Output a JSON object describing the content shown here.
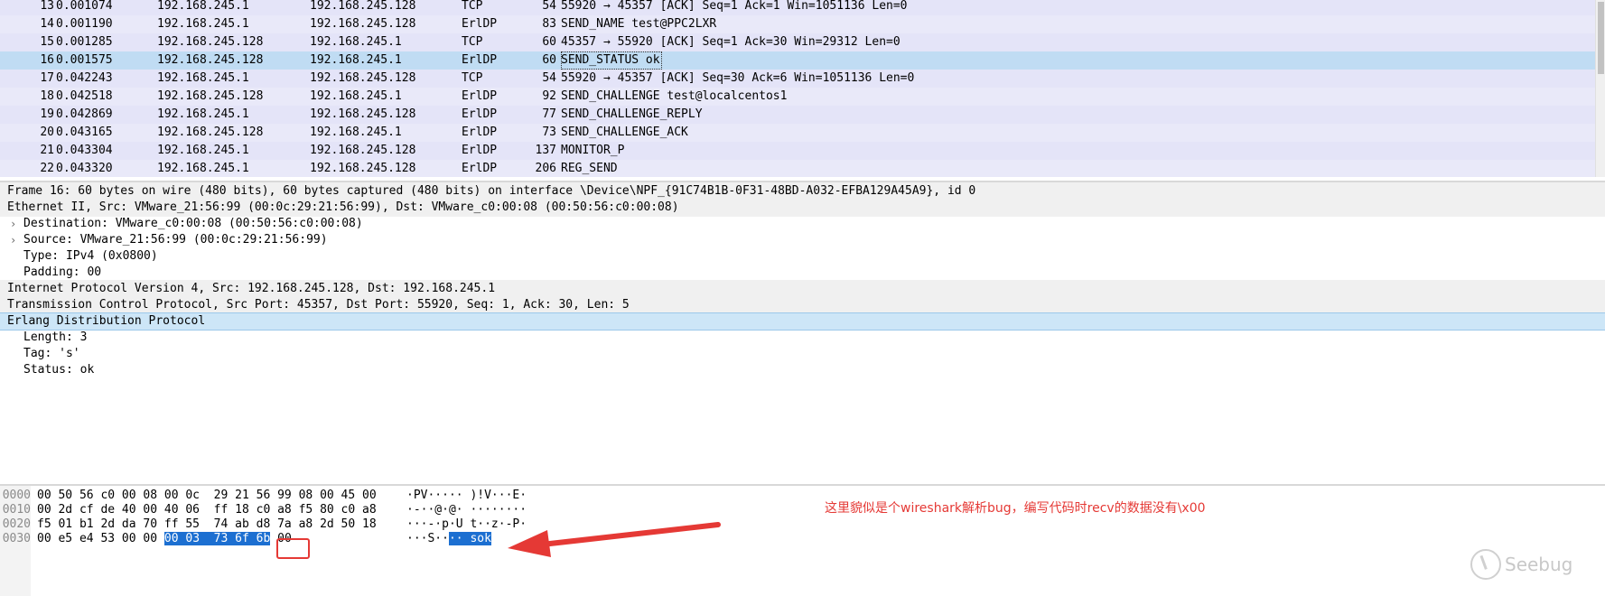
{
  "packet_list": {
    "rows": [
      {
        "no": "13",
        "time": "0.001074",
        "src": "192.168.245.1",
        "dst": "192.168.245.128",
        "proto": "TCP",
        "len": "54",
        "info": "55920 → 45357 [ACK] Seq=1 Ack=1 Win=1051136 Len=0"
      },
      {
        "no": "14",
        "time": "0.001190",
        "src": "192.168.245.1",
        "dst": "192.168.245.128",
        "proto": "ErlDP",
        "len": "83",
        "info": "SEND_NAME test@PPC2LXR"
      },
      {
        "no": "15",
        "time": "0.001285",
        "src": "192.168.245.128",
        "dst": "192.168.245.1",
        "proto": "TCP",
        "len": "60",
        "info": "45357 → 55920 [ACK] Seq=1 Ack=30 Win=29312 Len=0"
      },
      {
        "no": "16",
        "time": "0.001575",
        "src": "192.168.245.128",
        "dst": "192.168.245.1",
        "proto": "ErlDP",
        "len": "60",
        "info": "SEND_STATUS ok"
      },
      {
        "no": "17",
        "time": "0.042243",
        "src": "192.168.245.1",
        "dst": "192.168.245.128",
        "proto": "TCP",
        "len": "54",
        "info": "55920 → 45357 [ACK] Seq=30 Ack=6 Win=1051136 Len=0"
      },
      {
        "no": "18",
        "time": "0.042518",
        "src": "192.168.245.128",
        "dst": "192.168.245.1",
        "proto": "ErlDP",
        "len": "92",
        "info": "SEND_CHALLENGE test@localcentos1"
      },
      {
        "no": "19",
        "time": "0.042869",
        "src": "192.168.245.1",
        "dst": "192.168.245.128",
        "proto": "ErlDP",
        "len": "77",
        "info": "SEND_CHALLENGE_REPLY"
      },
      {
        "no": "20",
        "time": "0.043165",
        "src": "192.168.245.128",
        "dst": "192.168.245.1",
        "proto": "ErlDP",
        "len": "73",
        "info": "SEND_CHALLENGE_ACK"
      },
      {
        "no": "21",
        "time": "0.043304",
        "src": "192.168.245.1",
        "dst": "192.168.245.128",
        "proto": "ErlDP",
        "len": "137",
        "info": "MONITOR_P"
      },
      {
        "no": "22",
        "time": "0.043320",
        "src": "192.168.245.1",
        "dst": "192.168.245.128",
        "proto": "ErlDP",
        "len": "206",
        "info": "REG_SEND"
      }
    ],
    "selected_no": "16"
  },
  "detail_tree": [
    {
      "text": "Frame 16: 60 bytes on wire (480 bits), 60 bytes captured (480 bits) on interface \\Device\\NPF_{91C74B1B-0F31-48BD-A032-EFBA129A45A9}, id 0",
      "level": 0,
      "style": "grey"
    },
    {
      "text": "Ethernet II, Src: VMware_21:56:99 (00:0c:29:21:56:99), Dst: VMware_c0:00:08 (00:50:56:c0:00:08)",
      "level": 0,
      "style": "grey"
    },
    {
      "text": "Destination: VMware_c0:00:08 (00:50:56:c0:00:08)",
      "level": 1,
      "style": "",
      "expander": "›"
    },
    {
      "text": "Source: VMware_21:56:99 (00:0c:29:21:56:99)",
      "level": 1,
      "style": "",
      "expander": "›"
    },
    {
      "text": "Type: IPv4 (0x0800)",
      "level": 1,
      "style": ""
    },
    {
      "text": "Padding: 00",
      "level": 1,
      "style": ""
    },
    {
      "text": "Internet Protocol Version 4, Src: 192.168.245.128, Dst: 192.168.245.1",
      "level": 0,
      "style": "grey"
    },
    {
      "text": "Transmission Control Protocol, Src Port: 45357, Dst Port: 55920, Seq: 1, Ack: 30, Len: 5",
      "level": 0,
      "style": "grey"
    },
    {
      "text": "Erlang Distribution Protocol",
      "level": 0,
      "style": "sel"
    },
    {
      "text": "Length: 3",
      "level": 1,
      "style": ""
    },
    {
      "text": "Tag: 's'",
      "level": 1,
      "style": ""
    },
    {
      "text": "Status: ok",
      "level": 1,
      "style": ""
    }
  ],
  "hex_dump": [
    {
      "offset": "0000",
      "hex": "00 50 56 c0 00 08 00 0c  29 21 56 99 08 00 45 00",
      "ascii": "·PV····· )!V···E·"
    },
    {
      "offset": "0010",
      "hex": "00 2d cf de 40 00 40 06  ff 18 c0 a8 f5 80 c0 a8",
      "ascii": "·-··@·@· ········"
    },
    {
      "offset": "0020",
      "hex": "f5 01 b1 2d da 70 ff 55  74 ab d8 7a a8 2d 50 18",
      "ascii": "···-·p·U t··z·-P·"
    },
    {
      "offset": "0030",
      "hex_pre": "00 e5 e4 53 00 00 ",
      "hex_hl": "00 03  73 6f 6b",
      "hex_post": " 00",
      "ascii_pre": "···S··",
      "ascii_hl": "·· sok"
    }
  ],
  "annotation": "这里貌似是个wireshark解析bug，编写代码时recv的数据没有\\x00",
  "watermark": "Seebug",
  "colors": {
    "highlight": "#1c6fd1",
    "annotation": "#e53935",
    "selected_row": "#c0dcf3"
  }
}
